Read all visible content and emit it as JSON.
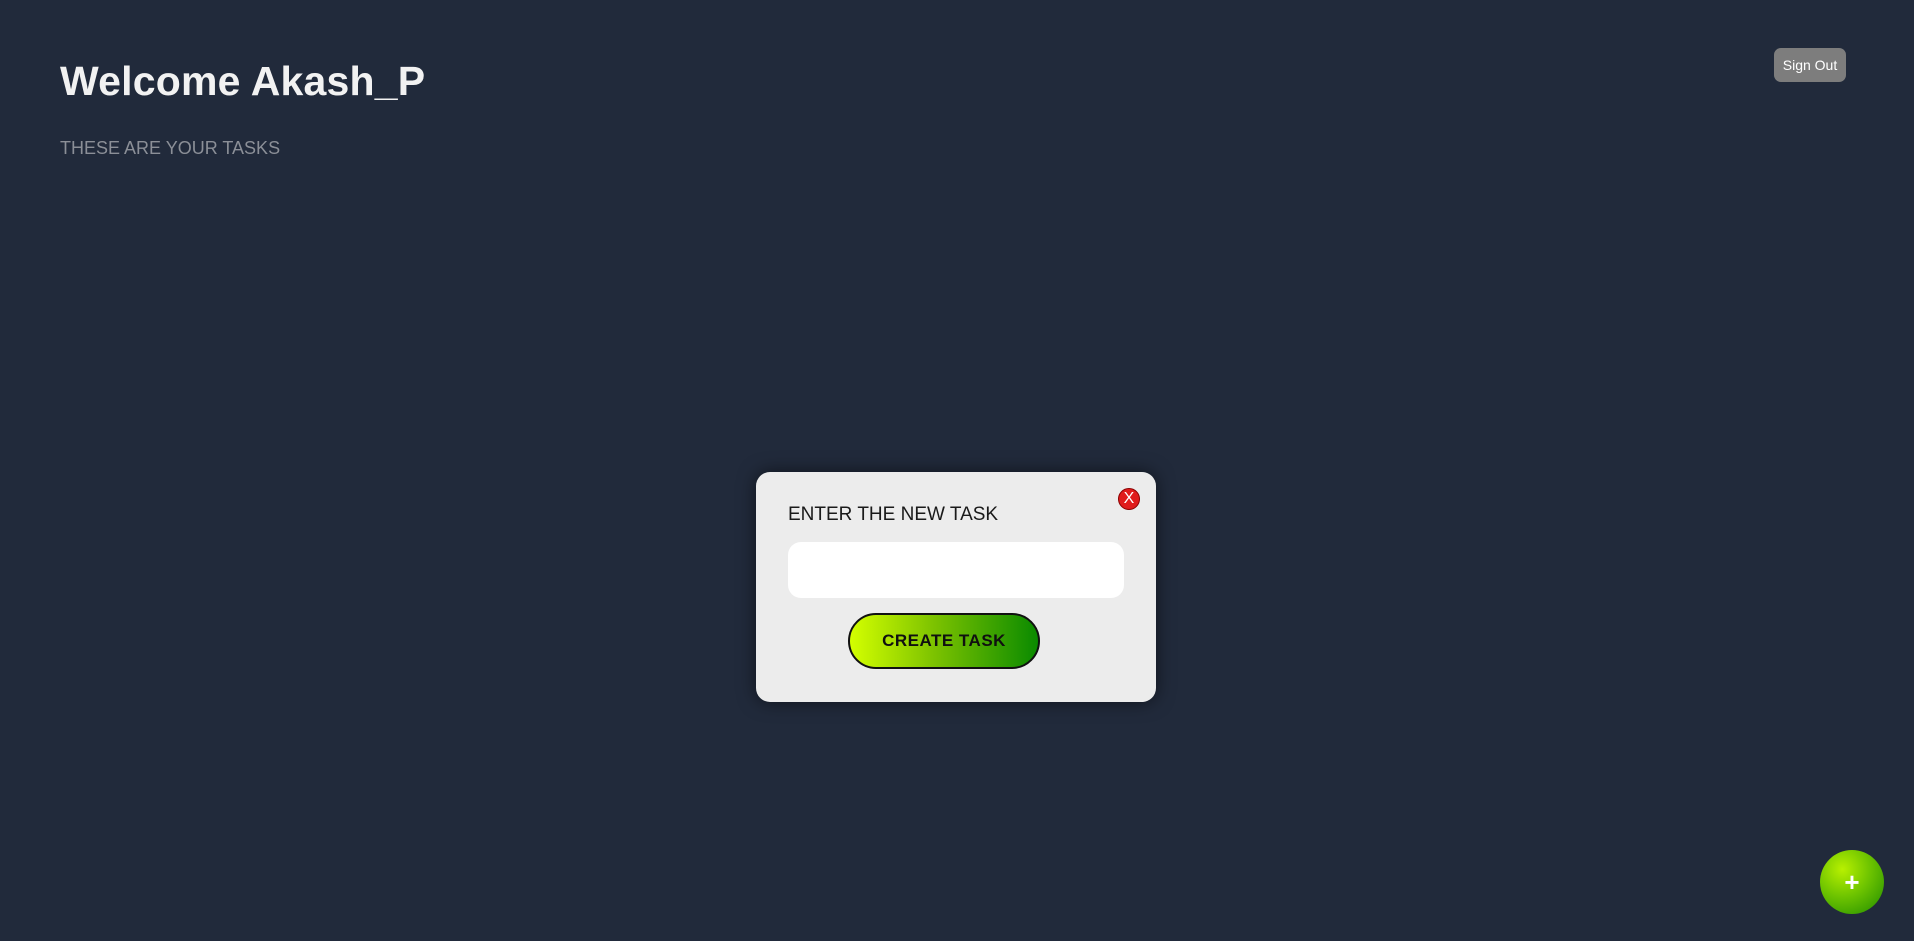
{
  "header": {
    "welcome_text": "Welcome Akash_P",
    "subtitle": "THESE ARE YOUR TASKS",
    "signout_label": "Sign Out"
  },
  "modal": {
    "label": "ENTER THE NEW TASK",
    "close_label": "X",
    "input_value": "",
    "input_placeholder": "",
    "create_button_label": "CREATE TASK"
  },
  "fab": {
    "label": "+",
    "icon": "plus-icon"
  },
  "colors": {
    "background": "#212a3b",
    "close_red": "#e01b1b",
    "gradient_start": "#d4ff00",
    "gradient_end": "#0a8a00",
    "signout_gray": "#7d7d7d"
  }
}
